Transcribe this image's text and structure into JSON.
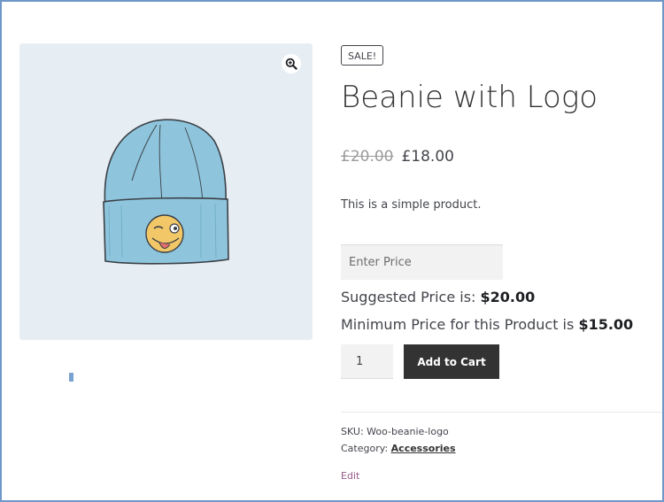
{
  "product": {
    "badge": "SALE!",
    "title": "Beanie with Logo",
    "regular_price": "£20.00",
    "sale_price": "£18.00",
    "description": "This is a simple product.",
    "price_input_placeholder": "Enter Price",
    "suggested_label": "Suggested Price is:",
    "suggested_value": "$20.00",
    "minimum_label": "Minimum Price for this Product is",
    "minimum_value": "$15.00",
    "quantity": "1",
    "add_to_cart_label": "Add to Cart",
    "sku_label": "SKU:",
    "sku_value": "Woo-beanie-logo",
    "category_label": "Category:",
    "category_value": "Accessories",
    "edit_label": "Edit"
  },
  "icons": {
    "zoom": "magnifier-plus-icon"
  },
  "colors": {
    "gallery_bg": "#e7eef3",
    "button_bg": "#333333",
    "button_text": "#ffffff",
    "link_purple": "#96588a",
    "frame_border": "#6f98c9",
    "beanie_blue": "#8ec5dd",
    "emoji_yellow": "#f2c768"
  }
}
